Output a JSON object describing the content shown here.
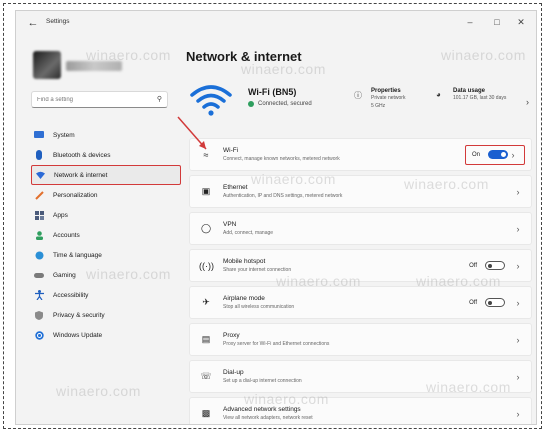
{
  "window": {
    "title": "Settings"
  },
  "search": {
    "placeholder": "Find a setting"
  },
  "sidebar": {
    "items": [
      {
        "label": "System",
        "icon": "monitor-icon"
      },
      {
        "label": "Bluetooth & devices",
        "icon": "bluetooth-icon"
      },
      {
        "label": "Network & internet",
        "icon": "network-icon",
        "selected": true
      },
      {
        "label": "Personalization",
        "icon": "brush-icon"
      },
      {
        "label": "Apps",
        "icon": "apps-icon"
      },
      {
        "label": "Accounts",
        "icon": "person-icon"
      },
      {
        "label": "Time & language",
        "icon": "globe-icon"
      },
      {
        "label": "Gaming",
        "icon": "gamepad-icon"
      },
      {
        "label": "Accessibility",
        "icon": "accessibility-icon"
      },
      {
        "label": "Privacy & security",
        "icon": "shield-icon"
      },
      {
        "label": "Windows Update",
        "icon": "update-icon"
      }
    ]
  },
  "main": {
    "title": "Network & internet",
    "hero": {
      "name": "Wi-Fi (BN5)",
      "status": "Connected, secured",
      "properties": {
        "title": "Properties",
        "line1": "Private network",
        "line2": "5 GHz"
      },
      "usage": {
        "title": "Data usage",
        "line1": "101.17 GB, last 30 days"
      }
    },
    "rows": [
      {
        "title": "Wi-Fi",
        "subtitle": "Connect, manage known networks, metered network",
        "toggle": "On"
      },
      {
        "title": "Ethernet",
        "subtitle": "Authentication, IP and DNS settings, metered network"
      },
      {
        "title": "VPN",
        "subtitle": "Add, connect, manage"
      },
      {
        "title": "Mobile hotspot",
        "subtitle": "Share your internet connection",
        "toggle": "Off"
      },
      {
        "title": "Airplane mode",
        "subtitle": "Stop all wireless communication",
        "toggle": "Off"
      },
      {
        "title": "Proxy",
        "subtitle": "Proxy server for Wi-Fi and Ethernet connections"
      },
      {
        "title": "Dial-up",
        "subtitle": "Set up a dial-up internet connection"
      },
      {
        "title": "Advanced network settings",
        "subtitle": "View all network adapters, network reset"
      }
    ]
  },
  "watermark": "winaero.com",
  "colors": {
    "accent": "#1a5fd0",
    "highlight": "#d23a3a",
    "connected": "#2e9e5e"
  }
}
